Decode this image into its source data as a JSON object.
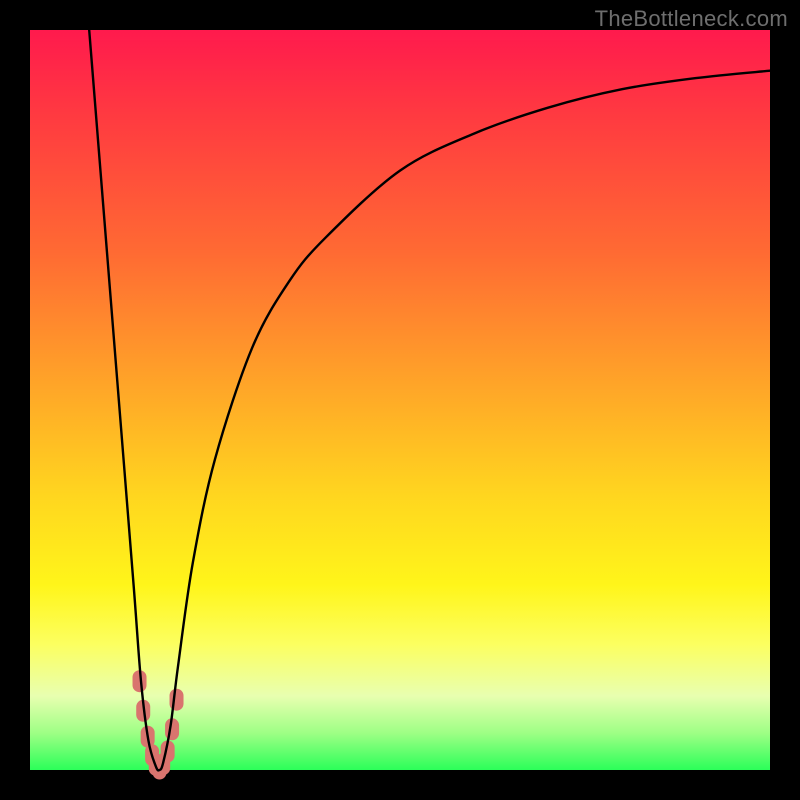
{
  "watermark": "TheBottleneck.com",
  "chart_data": {
    "type": "line",
    "title": "",
    "xlabel": "",
    "ylabel": "",
    "xlim": [
      0,
      100
    ],
    "ylim": [
      0,
      100
    ],
    "grid": false,
    "legend": false,
    "series": [
      {
        "name": "bottleneck-curve",
        "color": "#000000",
        "x": [
          8,
          10,
          12,
          14,
          15,
          16,
          17,
          17.5,
          18,
          19,
          20,
          22,
          25,
          30,
          35,
          40,
          50,
          60,
          70,
          80,
          90,
          100
        ],
        "y": [
          100,
          75,
          50,
          25,
          12,
          4,
          0.5,
          0,
          1,
          6,
          14,
          28,
          42,
          57,
          66,
          72,
          81,
          86,
          89.5,
          92,
          93.5,
          94.5
        ]
      }
    ],
    "markers": {
      "name": "bottleneck-confidence-band",
      "color": "#d9746e",
      "x": [
        14.8,
        15.3,
        15.9,
        16.5,
        17.0,
        17.5,
        18.0,
        18.6,
        19.2,
        19.8
      ],
      "y": [
        12.0,
        8.0,
        4.5,
        2.0,
        0.7,
        0.2,
        0.8,
        2.5,
        5.5,
        9.5
      ]
    },
    "vertex": {
      "x": 17.5,
      "y": 0
    }
  },
  "colors": {
    "frame": "#000000",
    "curve": "#000000",
    "marker": "#d9746e",
    "gradient_top": "#ff1a4d",
    "gradient_bottom": "#2bff59"
  }
}
